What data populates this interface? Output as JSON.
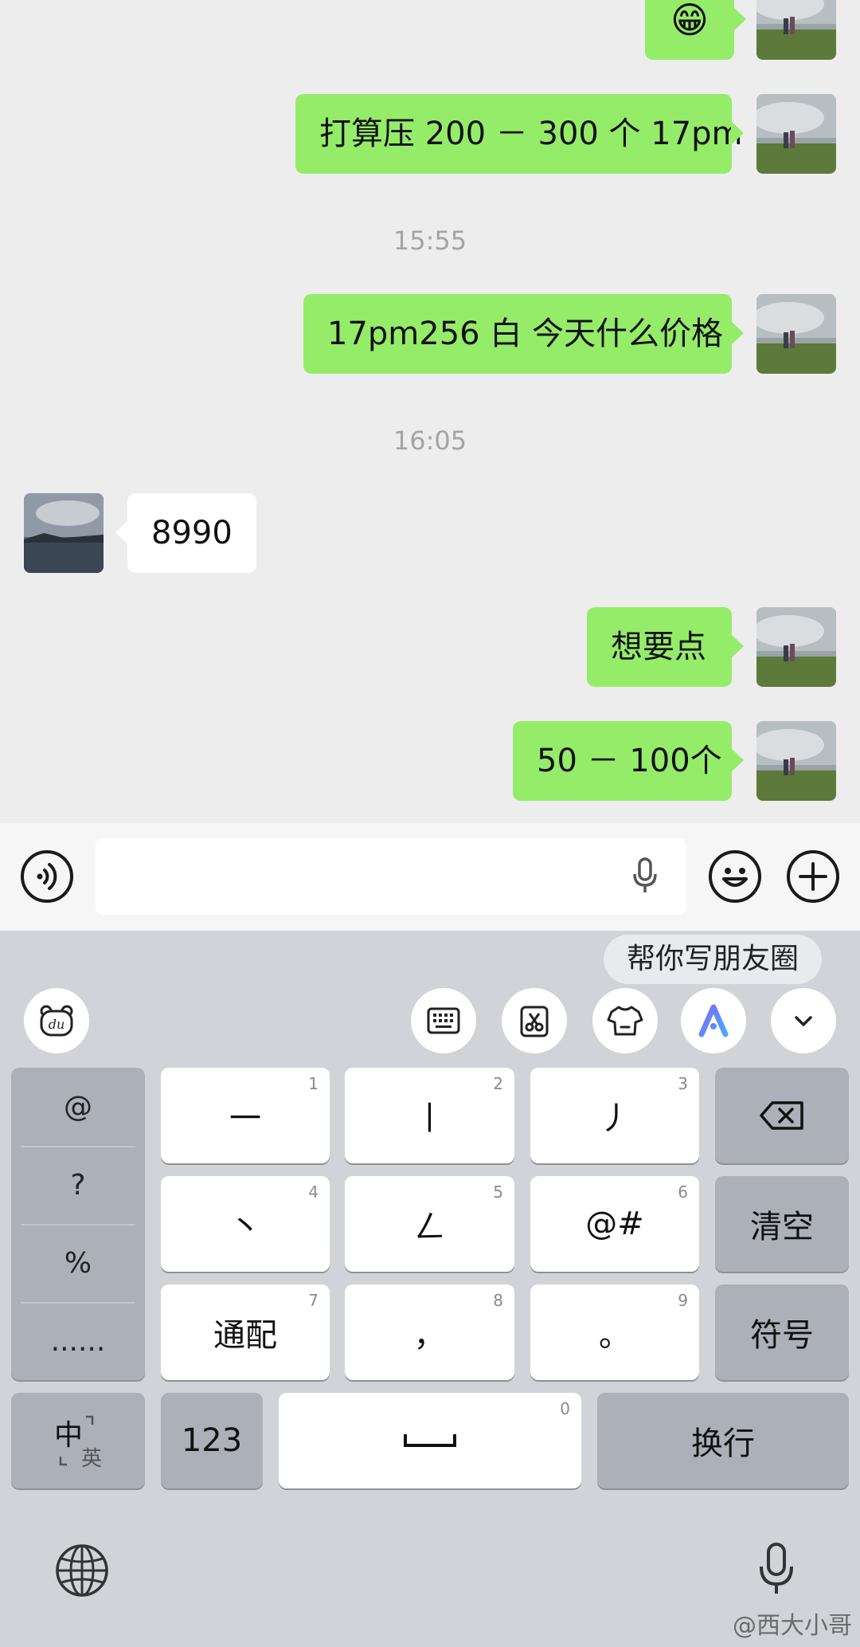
{
  "messages": [
    {
      "side": "mine",
      "emoji": "😁"
    },
    {
      "side": "mine",
      "text": "打算压 200 － 300 个 17pm"
    },
    {
      "side": "time",
      "text": "15:55"
    },
    {
      "side": "mine",
      "text": "17pm256 白 今天什么价格"
    },
    {
      "side": "time",
      "text": "16:05"
    },
    {
      "side": "theirs",
      "text": "8990"
    },
    {
      "side": "mine",
      "text": "想要点"
    },
    {
      "side": "mine",
      "text": "50 － 100个"
    }
  ],
  "input_bar": {
    "voice_icon": "voice-toggle-icon",
    "mic_icon": "microphone-icon",
    "emoji_icon": "emoji-icon",
    "plus_icon": "plus-icon"
  },
  "keyboard": {
    "suggestion": "帮你写朋友圈",
    "toolbar_icons": [
      "baidu-bear-icon",
      "keyboard-layout-icon",
      "clipboard-icon",
      "skin-icon",
      "ai-assistant-icon",
      "chevron-down-icon"
    ],
    "symbols": [
      "@",
      "?",
      "%",
      "......"
    ],
    "keys": [
      {
        "label": "一",
        "num": "1"
      },
      {
        "label": "丨",
        "num": "2"
      },
      {
        "label": "丿",
        "num": "3"
      },
      {
        "label": "丶",
        "num": "4"
      },
      {
        "label": "ㄥ",
        "num": "5"
      },
      {
        "label": "@#",
        "num": "6"
      },
      {
        "label": "通配",
        "num": "7"
      },
      {
        "label": "，",
        "num": "8"
      },
      {
        "label": "。",
        "num": "9"
      }
    ],
    "clear_label": "清空",
    "symbol_label": "符号",
    "lang_main": "中",
    "lang_sub": "英",
    "numbers_label": "123",
    "space_num": "0",
    "enter_label": "换行",
    "globe_icon": "globe-icon",
    "dictation_icon": "microphone-icon",
    "backspace_icon": "backspace-icon"
  },
  "watermark": "@西大小哥",
  "colors": {
    "sent_bubble": "#95ec69",
    "received_bubble": "#ffffff",
    "chat_bg": "#ededed",
    "keyboard_bg": "#d1d3d9",
    "ai_icon_gradient": [
      "#7b6cf6",
      "#4aa8ff"
    ]
  }
}
